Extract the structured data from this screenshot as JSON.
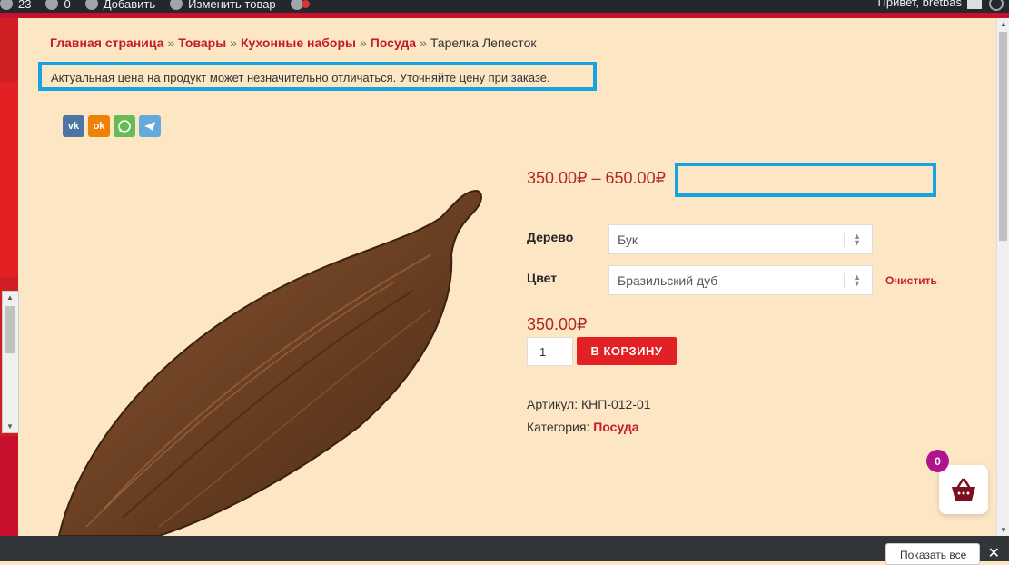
{
  "admin_bar": {
    "updates_count": "23",
    "comments_count": "0",
    "add_label": "Добавить",
    "edit_label": "Изменить товар",
    "greeting": "Привет, bretbas"
  },
  "breadcrumb": {
    "items": [
      "Главная страница",
      "Товары",
      "Кухонные наборы",
      "Посуда"
    ],
    "current": "Тарелка Лепесток",
    "separator": "»"
  },
  "notice": "Актуальная цена на продукт может незначительно отличаться. Уточняйте цену при заказе.",
  "share_icons": [
    "vk-icon",
    "odnoklassniki-icon",
    "whatsapp-icon",
    "telegram-icon"
  ],
  "product": {
    "price_range": "350.00₽ – 650.00₽",
    "variations": [
      {
        "label": "Дерево",
        "value": "Бук"
      },
      {
        "label": "Цвет",
        "value": "Бразильский дуб"
      }
    ],
    "clear_label": "Очистить",
    "variation_price": "350.00₽",
    "quantity": "1",
    "add_to_cart_label": "В КОРЗИНУ",
    "sku_label": "Артикул:",
    "sku": "КНП-012-01",
    "category_label": "Категория:",
    "category": "Посуда"
  },
  "cart": {
    "count": "0",
    "icon": "basket-icon"
  },
  "downloads_bar": {
    "show_all_label": "Показать все",
    "close_icon": "close-icon"
  },
  "colors": {
    "accent_red": "#c41e23",
    "button_red": "#e32024",
    "page_bg": "#fde6c4",
    "highlight_blue": "#17a2e0",
    "badge_purple": "#b0148c"
  }
}
